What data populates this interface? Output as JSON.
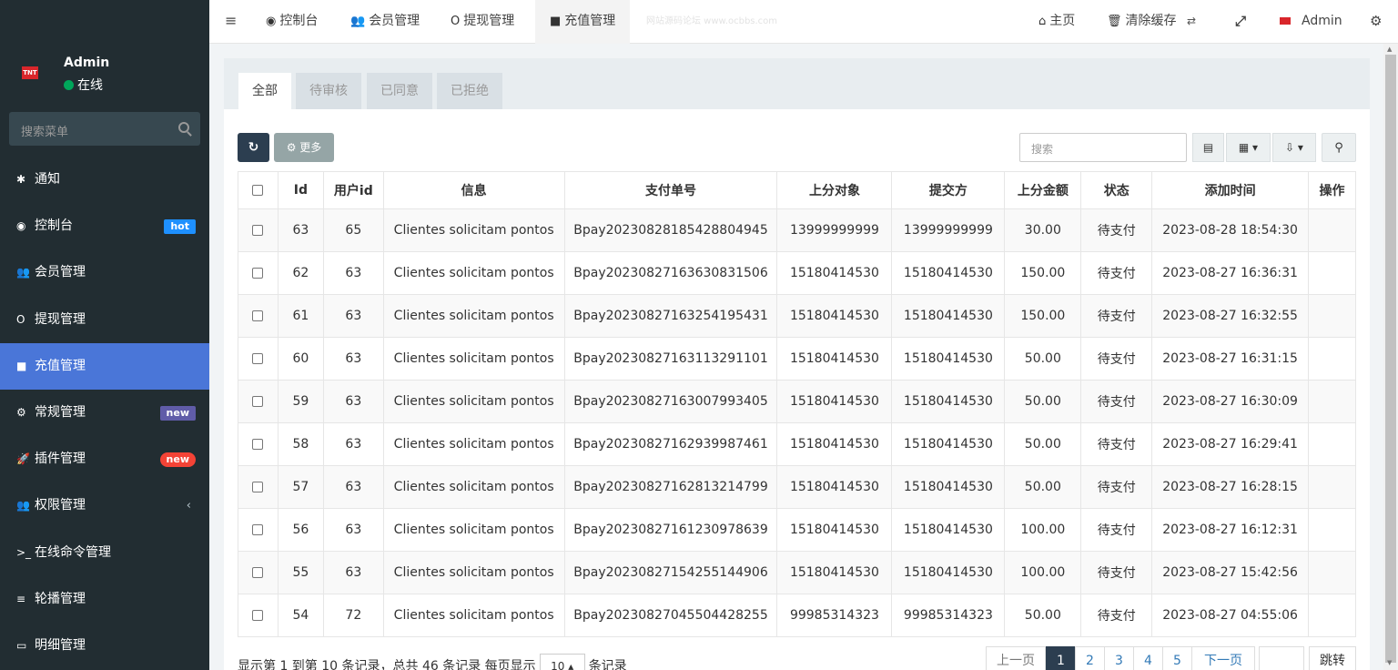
{
  "sidebar": {
    "logo_text": "TNT",
    "user_name": "Admin",
    "user_status": "在线",
    "search_placeholder": "搜索菜单",
    "items": [
      {
        "icon": "✱",
        "label": "通知"
      },
      {
        "icon": "◉",
        "label": "控制台",
        "badge": "hot"
      },
      {
        "icon": "👥",
        "label": "会员管理"
      },
      {
        "icon": "O",
        "label": "提现管理"
      },
      {
        "icon": "■",
        "label": "充值管理"
      },
      {
        "icon": "⚙",
        "label": "常规管理",
        "badge": "new"
      },
      {
        "icon": "🚀",
        "label": "插件管理",
        "badge": "new"
      },
      {
        "icon": "👥",
        "label": "权限管理",
        "chevron": "‹"
      },
      {
        "icon": ">_",
        "label": "在线命令管理"
      },
      {
        "icon": "≡",
        "label": "轮播管理"
      },
      {
        "icon": "▭",
        "label": "明细管理"
      }
    ]
  },
  "navbar": {
    "toggle_icon": "≡",
    "tabs": [
      {
        "icon": "◉",
        "label": "控制台"
      },
      {
        "icon": "👥",
        "label": "会员管理"
      },
      {
        "icon": "O",
        "label": "提现管理"
      },
      {
        "icon": "■",
        "label": "充值管理"
      }
    ],
    "watermark": "网站源码论坛 www.ocbbs.com",
    "home_icon": "⌂",
    "home_label": "主页",
    "clear_icon": "🗑",
    "clear_label": "清除缓存",
    "admin_label": "Admin"
  },
  "filter_tabs": [
    "全部",
    "待审核",
    "已同意",
    "已拒绝"
  ],
  "toolbar": {
    "refresh_icon": "↻",
    "more_label": "⚙ 更多",
    "search_placeholder": "搜索",
    "search_icon": "🔍"
  },
  "table": {
    "headers": [
      "Id",
      "用户id",
      "信息",
      "支付单号",
      "上分对象",
      "提交方",
      "上分金额",
      "状态",
      "添加时间",
      "操作"
    ],
    "rows": [
      [
        "63",
        "65",
        "Clientes solicitam pontos",
        "Bpay20230828185428804945",
        "13999999999",
        "13999999999",
        "30.00",
        "待支付",
        "2023-08-28 18:54:30",
        ""
      ],
      [
        "62",
        "63",
        "Clientes solicitam pontos",
        "Bpay20230827163630831506",
        "15180414530",
        "15180414530",
        "150.00",
        "待支付",
        "2023-08-27 16:36:31",
        ""
      ],
      [
        "61",
        "63",
        "Clientes solicitam pontos",
        "Bpay20230827163254195431",
        "15180414530",
        "15180414530",
        "150.00",
        "待支付",
        "2023-08-27 16:32:55",
        ""
      ],
      [
        "60",
        "63",
        "Clientes solicitam pontos",
        "Bpay20230827163113291101",
        "15180414530",
        "15180414530",
        "50.00",
        "待支付",
        "2023-08-27 16:31:15",
        ""
      ],
      [
        "59",
        "63",
        "Clientes solicitam pontos",
        "Bpay20230827163007993405",
        "15180414530",
        "15180414530",
        "50.00",
        "待支付",
        "2023-08-27 16:30:09",
        ""
      ],
      [
        "58",
        "63",
        "Clientes solicitam pontos",
        "Bpay20230827162939987461",
        "15180414530",
        "15180414530",
        "50.00",
        "待支付",
        "2023-08-27 16:29:41",
        ""
      ],
      [
        "57",
        "63",
        "Clientes solicitam pontos",
        "Bpay20230827162813214799",
        "15180414530",
        "15180414530",
        "50.00",
        "待支付",
        "2023-08-27 16:28:15",
        ""
      ],
      [
        "56",
        "63",
        "Clientes solicitam pontos",
        "Bpay20230827161230978639",
        "15180414530",
        "15180414530",
        "100.00",
        "待支付",
        "2023-08-27 16:12:31",
        ""
      ],
      [
        "55",
        "63",
        "Clientes solicitam pontos",
        "Bpay20230827154255144906",
        "15180414530",
        "15180414530",
        "100.00",
        "待支付",
        "2023-08-27 15:42:56",
        ""
      ],
      [
        "54",
        "72",
        "Clientes solicitam pontos",
        "Bpay20230827045504428255",
        "99985314323",
        "99985314323",
        "50.00",
        "待支付",
        "2023-08-27 04:55:06",
        ""
      ]
    ]
  },
  "pagination": {
    "info_prefix": "显示第 1 到第 10 条记录，总共 46 条记录 每页显示",
    "page_size": "10 ▴",
    "info_suffix": "条记录",
    "prev": "上一页",
    "pages": [
      "1",
      "2",
      "3",
      "4",
      "5"
    ],
    "next": "下一页",
    "jump": "跳转"
  }
}
